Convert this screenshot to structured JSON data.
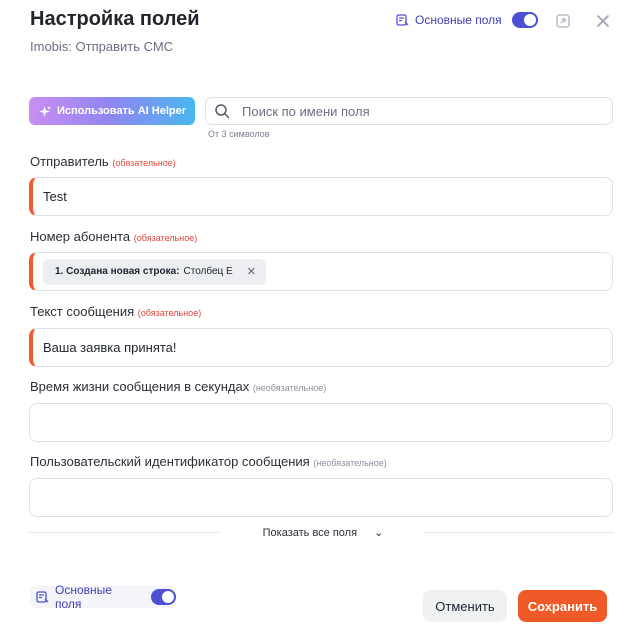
{
  "dialog": {
    "title": "Настройка полей",
    "subtitle": "Imobis: Отправить СМС",
    "main_fields_toggle_label": "Основные поля",
    "main_fields_toggle_on": true
  },
  "toolbar": {
    "ai_button_label": "Использовать AI Helper",
    "search_placeholder": "Поиск по имени поля",
    "search_hint": "От 3 символов"
  },
  "fields": [
    {
      "label": "Отправитель",
      "tag": "(обязательное)",
      "required": true,
      "value": "Test"
    },
    {
      "label": "Номер абонента",
      "tag": "(обязательное)",
      "required": true,
      "chip_bold": "1. Создана новая строка:",
      "chip_text": "Столбец Е"
    },
    {
      "label": "Текст сообщения",
      "tag": "(обязательное)",
      "required": true,
      "value": "Ваша заявка принята!"
    },
    {
      "label": "Время жизни сообщения в секундах",
      "tag": "(необязательное)",
      "required": false,
      "value": ""
    },
    {
      "label": "Пользовательский идентификатор сообщения",
      "tag": "(необязательное)",
      "required": false,
      "value": ""
    }
  ],
  "show_all_label": "Показать все поля",
  "footer": {
    "toggle_label": "Основные поля",
    "cancel_label": "Отменить",
    "save_label": "Сохранить"
  },
  "colors": {
    "accent": "#4f4fd6",
    "required_marker": "#f2592b",
    "save_button": "#f05a28"
  }
}
